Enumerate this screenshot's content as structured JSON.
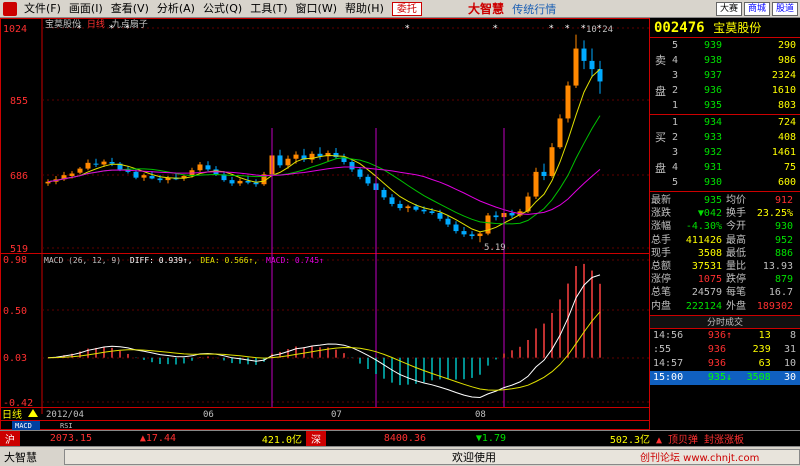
{
  "menubar": {
    "items": [
      {
        "label": "文件(F)"
      },
      {
        "label": "画面(I)"
      },
      {
        "label": "查看(V)"
      },
      {
        "label": "分析(A)"
      },
      {
        "label": "公式(Q)"
      },
      {
        "label": "工具(T)"
      },
      {
        "label": "窗口(W)"
      },
      {
        "label": "帮助(H)"
      }
    ],
    "hot_button": "委托",
    "brand": "大智慧",
    "brand_sub": "传统行情",
    "right_buttons": [
      "大赛",
      "商城",
      "股道"
    ]
  },
  "chart_header": {
    "title_name": "宝莫股份",
    "title_period": "日线",
    "title_extra": "九点扇子"
  },
  "chart_data": [
    {
      "type": "candlestick",
      "title": "宝莫股份 日线",
      "y_ticks": [
        "1024",
        "855",
        "686",
        "519"
      ],
      "ylim": [
        5.0,
        10.4
      ],
      "high_label": "10.24",
      "low_label": "5.19",
      "date_labels": [
        "2012/04",
        "06",
        "07",
        "08"
      ],
      "ohlc": [
        [
          6.62,
          6.72,
          6.56,
          6.66
        ],
        [
          6.66,
          6.8,
          6.6,
          6.72
        ],
        [
          6.72,
          6.9,
          6.68,
          6.82
        ],
        [
          6.8,
          6.92,
          6.74,
          6.86
        ],
        [
          6.88,
          7.02,
          6.84,
          6.98
        ],
        [
          6.98,
          7.2,
          6.94,
          7.12
        ],
        [
          7.1,
          7.22,
          7.02,
          7.08
        ],
        [
          7.08,
          7.2,
          7.02,
          7.15
        ],
        [
          7.14,
          7.24,
          7.04,
          7.1
        ],
        [
          7.1,
          7.14,
          6.92,
          6.96
        ],
        [
          6.96,
          7.04,
          6.86,
          6.9
        ],
        [
          6.9,
          6.96,
          6.72,
          6.76
        ],
        [
          6.76,
          6.86,
          6.68,
          6.82
        ],
        [
          6.8,
          6.92,
          6.72,
          6.74
        ],
        [
          6.74,
          6.82,
          6.64,
          6.7
        ],
        [
          6.7,
          6.8,
          6.62,
          6.76
        ],
        [
          6.76,
          6.86,
          6.7,
          6.72
        ],
        [
          6.74,
          6.84,
          6.68,
          6.8
        ],
        [
          6.8,
          7.0,
          6.76,
          6.94
        ],
        [
          6.94,
          7.14,
          6.9,
          7.08
        ],
        [
          7.06,
          7.16,
          6.92,
          6.96
        ],
        [
          6.96,
          7.04,
          6.8,
          6.84
        ],
        [
          6.84,
          6.92,
          6.66,
          6.7
        ],
        [
          6.7,
          6.78,
          6.56,
          6.62
        ],
        [
          6.62,
          6.74,
          6.56,
          6.68
        ],
        [
          6.68,
          6.8,
          6.6,
          6.64
        ],
        [
          6.64,
          6.72,
          6.54,
          6.6
        ],
        [
          6.6,
          6.9,
          6.56,
          6.84
        ],
        [
          6.84,
          7.46,
          6.8,
          7.3
        ],
        [
          7.3,
          7.44,
          7.0,
          7.06
        ],
        [
          7.06,
          7.3,
          6.98,
          7.22
        ],
        [
          7.22,
          7.4,
          7.1,
          7.32
        ],
        [
          7.3,
          7.46,
          7.14,
          7.2
        ],
        [
          7.2,
          7.4,
          7.12,
          7.34
        ],
        [
          7.34,
          7.5,
          7.2,
          7.28
        ],
        [
          7.28,
          7.42,
          7.14,
          7.36
        ],
        [
          7.36,
          7.48,
          7.22,
          7.26
        ],
        [
          7.26,
          7.34,
          7.08,
          7.14
        ],
        [
          7.14,
          7.2,
          6.9,
          6.96
        ],
        [
          6.96,
          7.02,
          6.72,
          6.78
        ],
        [
          6.78,
          6.84,
          6.56,
          6.62
        ],
        [
          6.62,
          6.7,
          6.4,
          6.46
        ],
        [
          6.46,
          6.52,
          6.22,
          6.28
        ],
        [
          6.28,
          6.36,
          6.06,
          6.12
        ],
        [
          6.12,
          6.2,
          5.96,
          6.02
        ],
        [
          6.02,
          6.1,
          5.92,
          6.06
        ],
        [
          6.06,
          6.12,
          5.94,
          5.98
        ],
        [
          5.98,
          6.06,
          5.88,
          5.94
        ],
        [
          5.94,
          6.02,
          5.86,
          5.9
        ],
        [
          5.9,
          5.98,
          5.7,
          5.76
        ],
        [
          5.76,
          5.84,
          5.56,
          5.62
        ],
        [
          5.62,
          5.7,
          5.4,
          5.46
        ],
        [
          5.46,
          5.56,
          5.32,
          5.38
        ],
        [
          5.38,
          5.46,
          5.26,
          5.34
        ],
        [
          5.34,
          5.44,
          5.19,
          5.4
        ],
        [
          5.4,
          5.9,
          5.36,
          5.84
        ],
        [
          5.84,
          5.94,
          5.72,
          5.8
        ],
        [
          5.8,
          5.96,
          5.74,
          5.9
        ],
        [
          5.9,
          5.98,
          5.78,
          5.84
        ],
        [
          5.84,
          6.0,
          5.8,
          5.94
        ],
        [
          5.94,
          6.4,
          5.9,
          6.3
        ],
        [
          6.3,
          7.0,
          6.24,
          6.9
        ],
        [
          6.9,
          7.1,
          6.7,
          6.8
        ],
        [
          6.8,
          7.6,
          6.76,
          7.5
        ],
        [
          7.5,
          8.3,
          7.46,
          8.2
        ],
        [
          8.2,
          9.1,
          8.1,
          9.0
        ],
        [
          9.0,
          10.24,
          8.94,
          9.9
        ],
        [
          9.9,
          10.1,
          9.4,
          9.6
        ],
        [
          9.6,
          9.9,
          9.2,
          9.4
        ],
        [
          9.4,
          9.6,
          8.8,
          9.1
        ]
      ]
    },
    {
      "type": "macd",
      "params": "MACD (26, 12, 9)",
      "diff_label": "DIFF",
      "diff_value": "0.939",
      "dea_label": "DEA",
      "dea_value": "0.566",
      "macd_label": "MACD",
      "macd_value": "0.745",
      "y_ticks": [
        "0.98",
        "0.50",
        "0.03",
        "-0.42"
      ],
      "ylim": [
        -0.45,
        1.0
      ]
    }
  ],
  "chart_bottom": {
    "period": "日线",
    "tabs": [
      "MACD",
      "RSI"
    ]
  },
  "quote": {
    "code": "002476",
    "name": "宝莫股份",
    "sell_label_1": "卖",
    "sell_label_2": "盘",
    "buy_label_1": "买",
    "buy_label_2": "盘",
    "asks": [
      {
        "lvl": "5",
        "price": "939",
        "vol": "290"
      },
      {
        "lvl": "4",
        "price": "938",
        "vol": "986"
      },
      {
        "lvl": "3",
        "price": "937",
        "vol": "2324"
      },
      {
        "lvl": "2",
        "price": "936",
        "vol": "1610"
      },
      {
        "lvl": "1",
        "price": "935",
        "vol": "803"
      }
    ],
    "bids": [
      {
        "lvl": "1",
        "price": "934",
        "vol": "724"
      },
      {
        "lvl": "2",
        "price": "933",
        "vol": "408"
      },
      {
        "lvl": "3",
        "price": "932",
        "vol": "1461"
      },
      {
        "lvl": "4",
        "price": "931",
        "vol": "75"
      },
      {
        "lvl": "5",
        "price": "930",
        "vol": "600"
      }
    ],
    "stats": [
      {
        "l1": "最新",
        "v1": "935",
        "l2": "均价",
        "v2": "912"
      },
      {
        "l1": "涨跌",
        "v1": "▼042",
        "l2": "换手",
        "v2": "23.25%"
      },
      {
        "l1": "涨幅",
        "v1": "-4.30%",
        "l2": "今开",
        "v2": "930"
      },
      {
        "l1": "总手",
        "v1": "411426",
        "l2": "最高",
        "v2": "952"
      },
      {
        "l1": "现手",
        "v1": "3508",
        "l2": "最低",
        "v2": "886"
      },
      {
        "l1": "总额",
        "v1": "37531",
        "l2": "量比",
        "v2": "13.93"
      },
      {
        "l1": "涨停",
        "v1": "1075",
        "l2": "跌停",
        "v2": "879"
      },
      {
        "l1": "总笔",
        "v1": "24579",
        "l2": "每笔",
        "v2": "16.7"
      },
      {
        "l1": "内盘",
        "v1": "222124",
        "l2": "外盘",
        "v2": "189302"
      }
    ],
    "tick_tab": "分时成交",
    "ticks": [
      {
        "t": "14:56",
        "p": "936",
        "arrow": "↑",
        "v": "13",
        "n": "8"
      },
      {
        "t": ":55",
        "p": "936",
        "arrow": "",
        "v": "239",
        "n": "31"
      },
      {
        "t": "14:57",
        "p": "936",
        "arrow": "",
        "v": "63",
        "n": "10"
      },
      {
        "t": "15:00",
        "p": "935",
        "arrow": "↓",
        "v": "3508",
        "n": "30"
      }
    ]
  },
  "status": {
    "sh_label": "沪",
    "sh_index": "2073.15",
    "sh_change": "▲17.44",
    "sh_amount": "421.0亿",
    "sz_label": "深",
    "sz_index": "8400.36",
    "sz_change": "▼1.79",
    "sz_amount": "502.3亿",
    "news": "▲ 顶贝弹 封涨涨板",
    "app_name": "大智慧",
    "welcome": "欢迎使用",
    "watermark": "创刊论坛 www.chnjt.com"
  }
}
